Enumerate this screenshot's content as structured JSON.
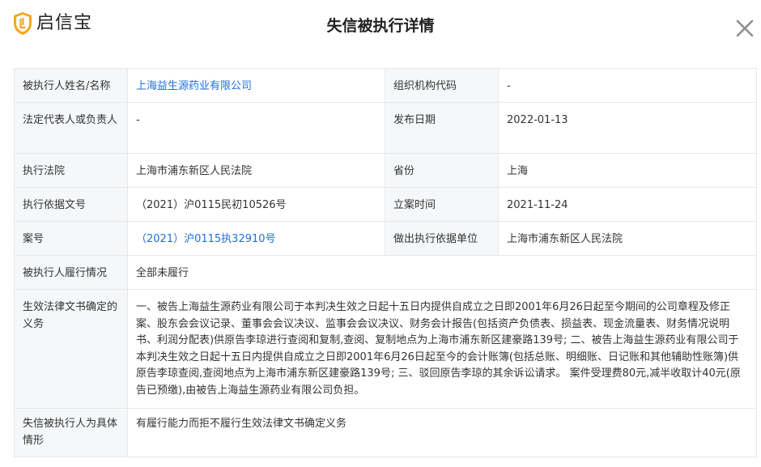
{
  "header": {
    "logo_text": "启信宝",
    "title": "失信被执行详情",
    "close_icon": "close-icon",
    "logo_icon": "shield-logo-icon"
  },
  "colors": {
    "link": "#1e6fd9",
    "key_bg": "#f5f7f9",
    "border": "#e8e8e8",
    "logo_orange": "#f5a623"
  },
  "rows": {
    "r1": {
      "k1": "被执行人姓名/名称",
      "v1": "上海益生源药业有限公司",
      "k2": "组织机构代码",
      "v2": "-"
    },
    "r2": {
      "k1": "法定代表人或负责人",
      "v1": "-",
      "k2": "发布日期",
      "v2": "2022-01-13"
    },
    "r3": {
      "k1": "执行法院",
      "v1": "上海市浦东新区人民法院",
      "k2": "省份",
      "v2": "上海"
    },
    "r4": {
      "k1": "执行依据文号",
      "v1": "（2021）沪0115民初10526号",
      "k2": "立案时间",
      "v2": "2021-11-24"
    },
    "r5": {
      "k1": "案号",
      "v1": "（2021）沪0115执32910号",
      "k2": "做出执行依据单位",
      "v2": "上海市浦东新区人民法院"
    },
    "r6": {
      "k1": "被执行人履行情况",
      "v1": "全部未履行"
    },
    "r7": {
      "k1": "生效法律文书确定的义务",
      "v1": "一、被告上海益生源药业有限公司于本判决生效之日起十五日内提供自成立之日即2001年6月26日起至今期间的公司章程及修正案、股东会会议记录、董事会会议决议、监事会会议决议、财务会计报告(包括资产负债表、损益表、现金流量表、财务情况说明书、利润分配表)供原告李琼进行查阅和复制,查阅、复制地点为上海市浦东新区建豪路139号; 二、被告上海益生源药业有限公司于本判决生效之日起十五日内提供自成立之日即2001年6月26日起至今的会计账簿(包括总账、明细账、日记账和其他辅助性账簿)供原告李琼查阅,查阅地点为上海市浦东新区建豪路139号; 三、驳回原告李琼的其余诉讼请求。 案件受理费80元,减半收取计40元(原告已预缴),由被告上海益生源药业有限公司负担。"
    },
    "r8": {
      "k1": "失信被执行人为具体情形",
      "v1": "有履行能力而拒不履行生效法律文书确定义务"
    }
  }
}
